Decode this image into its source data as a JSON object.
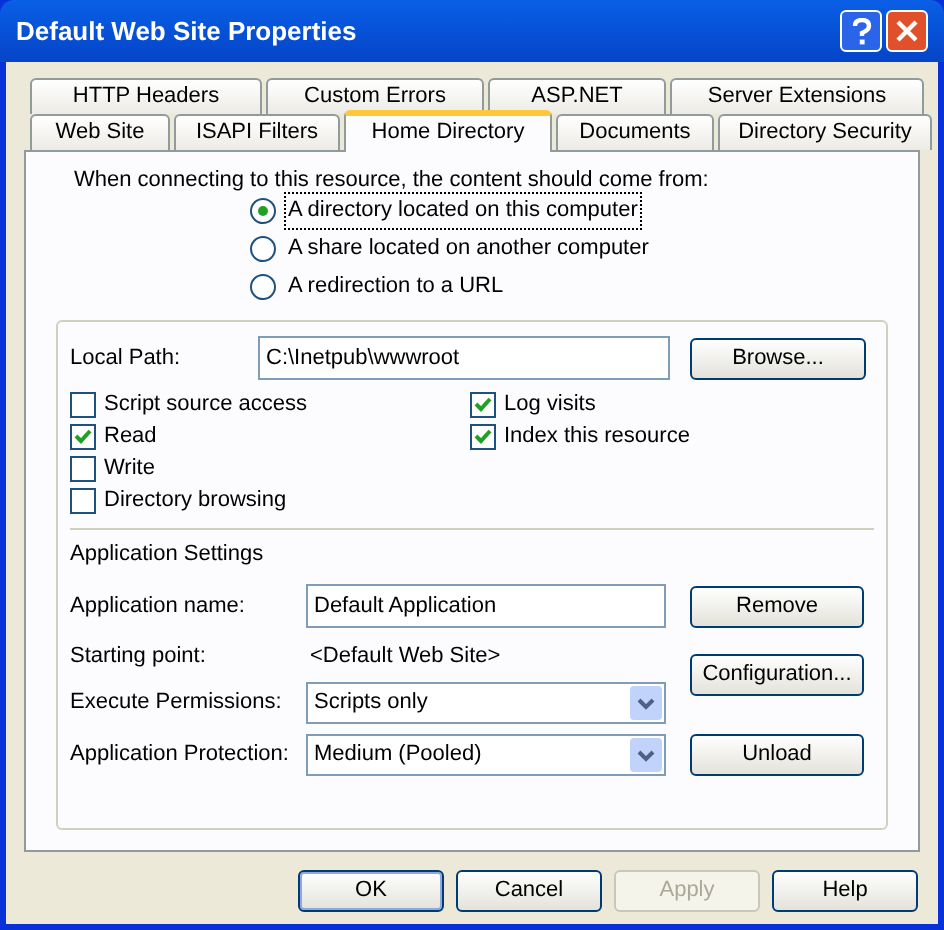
{
  "window": {
    "title": "Default Web Site Properties"
  },
  "tab_rows": [
    [
      {
        "label": "HTTP Headers",
        "selected": false
      },
      {
        "label": "Custom Errors",
        "selected": false
      },
      {
        "label": "ASP.NET",
        "selected": false
      },
      {
        "label": "Server Extensions",
        "selected": false
      }
    ],
    [
      {
        "label": "Web Site",
        "selected": false
      },
      {
        "label": "ISAPI Filters",
        "selected": false
      },
      {
        "label": "Home Directory",
        "selected": true
      },
      {
        "label": "Documents",
        "selected": false
      },
      {
        "label": "Directory Security",
        "selected": false
      }
    ]
  ],
  "source_prompt": "When connecting to this resource, the content should come from:",
  "source_options": [
    {
      "label": "A directory located on this computer",
      "selected": true
    },
    {
      "label": "A share located on another computer",
      "selected": false
    },
    {
      "label": "A redirection to a URL",
      "selected": false
    }
  ],
  "local_path": {
    "label": "Local Path:",
    "value": "C:\\Inetpub\\wwwroot",
    "button": "Browse..."
  },
  "checkboxes_left": [
    {
      "label": "Script source access",
      "checked": false
    },
    {
      "label": "Read",
      "checked": true
    },
    {
      "label": "Write",
      "checked": false
    },
    {
      "label": "Directory browsing",
      "checked": false
    }
  ],
  "checkboxes_right": [
    {
      "label": "Log visits",
      "checked": true
    },
    {
      "label": "Index this resource",
      "checked": true
    }
  ],
  "app_settings": {
    "heading": "Application Settings",
    "app_name": {
      "label": "Application name:",
      "value": "Default Application",
      "button": "Remove"
    },
    "starting_point": {
      "label": "Starting point:",
      "value": "<Default Web Site>",
      "button": "Configuration..."
    },
    "execute_permissions": {
      "label": "Execute Permissions:",
      "value": "Scripts only"
    },
    "app_protection": {
      "label": "Application Protection:",
      "value": "Medium (Pooled)",
      "button": "Unload"
    }
  },
  "buttons": [
    {
      "label": "OK",
      "disabled": false,
      "default": true
    },
    {
      "label": "Cancel",
      "disabled": false,
      "default": false
    },
    {
      "label": "Apply",
      "disabled": true,
      "default": false
    },
    {
      "label": "Help",
      "disabled": false,
      "default": false
    }
  ]
}
